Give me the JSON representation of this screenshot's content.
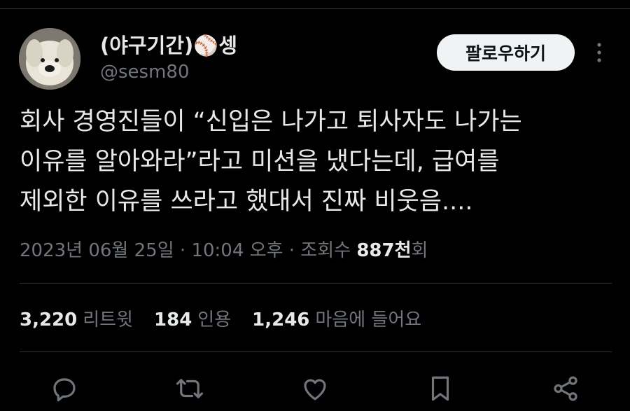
{
  "user": {
    "display_name": "(야구기간)⚾셍",
    "handle": "@sesm80"
  },
  "follow_button_label": "팔로우하기",
  "tweet": {
    "lines": [
      "회사 경영진들이 “신입은 나가고 퇴사자도 나가는",
      "이유를 알아와라”라고 미션을 냈다는데, 급여를",
      "제외한 이유를 쓰라고 했대서 진짜 비웃음...."
    ]
  },
  "meta": {
    "date": "2023년 06월 25일",
    "separator1": " · ",
    "time": "10:04 오후",
    "separator2": " · ",
    "views_prefix": "조회수 ",
    "views_count": "887천",
    "views_suffix": "회"
  },
  "stats": [
    {
      "count": "3,220",
      "label": "리트윗"
    },
    {
      "count": "184",
      "label": "인용"
    },
    {
      "count": "1,246",
      "label": "마음에 들어요"
    }
  ],
  "icons": {
    "reply": "reply-icon",
    "retweet": "retweet-icon",
    "like": "heart-icon",
    "bookmark": "bookmark-icon",
    "share": "share-icon"
  }
}
